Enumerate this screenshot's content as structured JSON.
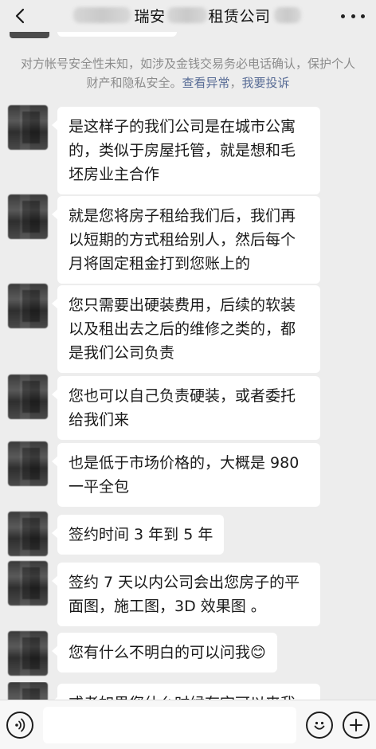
{
  "header": {
    "title": "瑞安",
    "title_suffix": "租赁公司"
  },
  "notice": {
    "text": "对方帐号安全性未知，如涉及金钱交易务必电话确认，保护个人财产和隐私安全。",
    "link_report_anomaly": "查看异常",
    "separator": "，",
    "link_complain": "我要投诉"
  },
  "messages": [
    {
      "lines": [
        "是这样子的我们公司是在城市公寓",
        "的，类似于房屋托管，就是想和毛",
        "坯房业主合作"
      ]
    },
    {
      "lines": [
        "就是您将房子租给我们后，我们再",
        "以短期的方式租给别人，然后每个",
        "月将固定租金打到您账上的"
      ]
    },
    {
      "lines": [
        "您只需要出硬装费用，后续的软装",
        "以及租出去之后的维修之类的，都",
        "是我们公司负责"
      ]
    },
    {
      "lines": [
        "您也可以自己负责硬装，或者委托",
        "给我们来"
      ]
    },
    {
      "lines": [
        "也是低于市场价格的，大概是 980",
        "一平全包"
      ]
    },
    {
      "lines": [
        "签约时间 3 年到 5 年"
      ]
    },
    {
      "lines": [
        "签约 7 天以内公司会出您房子的平",
        "面图，施工图，3D 效果图 。"
      ]
    },
    {
      "lines": [
        "您有什么不明白的可以问我😊"
      ]
    },
    {
      "lines": [
        "或者如果您什么时候有空可以来我"
      ]
    }
  ],
  "icons": {
    "back": "chevron-left-icon",
    "more": "more-dots-icon",
    "voice": "voice-icon",
    "emoji": "emoji-icon",
    "plus": "plus-icon"
  }
}
